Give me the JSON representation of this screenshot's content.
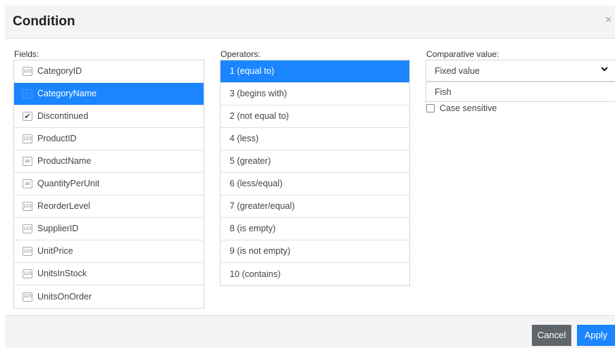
{
  "dialog": {
    "title": "Condition",
    "close_glyph": "×"
  },
  "fields": {
    "label": "Fields:",
    "items": [
      {
        "label": "CategoryID",
        "icon": "number-type-icon",
        "glyph": "123",
        "selected": false
      },
      {
        "label": "CategoryName",
        "icon": "text-type-icon",
        "glyph": "ab",
        "selected": true
      },
      {
        "label": "Discontinued",
        "icon": "boolean-type-icon",
        "glyph": "✔",
        "selected": false
      },
      {
        "label": "ProductID",
        "icon": "number-type-icon",
        "glyph": "123",
        "selected": false
      },
      {
        "label": "ProductName",
        "icon": "text-type-icon",
        "glyph": "ab",
        "selected": false
      },
      {
        "label": "QuantityPerUnit",
        "icon": "text-type-icon",
        "glyph": "ab",
        "selected": false
      },
      {
        "label": "ReorderLevel",
        "icon": "number-type-icon",
        "glyph": "123",
        "selected": false
      },
      {
        "label": "SupplierID",
        "icon": "number-type-icon",
        "glyph": "123",
        "selected": false
      },
      {
        "label": "UnitPrice",
        "icon": "number-type-icon",
        "glyph": "123",
        "selected": false
      },
      {
        "label": "UnitsInStock",
        "icon": "number-type-icon",
        "glyph": "123",
        "selected": false
      },
      {
        "label": "UnitsOnOrder",
        "icon": "number-type-icon",
        "glyph": "123",
        "selected": false
      }
    ]
  },
  "operators": {
    "label": "Operators:",
    "items": [
      {
        "label": "1 (equal to)",
        "selected": true
      },
      {
        "label": "3 (begins with)",
        "selected": false
      },
      {
        "label": "2 (not equal to)",
        "selected": false
      },
      {
        "label": "4 (less)",
        "selected": false
      },
      {
        "label": "5 (greater)",
        "selected": false
      },
      {
        "label": "6 (less/equal)",
        "selected": false
      },
      {
        "label": "7 (greater/equal)",
        "selected": false
      },
      {
        "label": "8 (is empty)",
        "selected": false
      },
      {
        "label": "9 (is not empty)",
        "selected": false
      },
      {
        "label": "10 (contains)",
        "selected": false
      }
    ]
  },
  "comparative": {
    "label": "Comparative value:",
    "mode_selected": "Fixed value",
    "value": "Fish",
    "case_sensitive_label": "Case sensitive",
    "case_sensitive": false
  },
  "footer": {
    "cancel_label": "Cancel",
    "apply_label": "Apply"
  },
  "colors": {
    "accent": "#1a85ff",
    "cancel": "#5e656b",
    "header_bg": "#f4f4f4"
  }
}
